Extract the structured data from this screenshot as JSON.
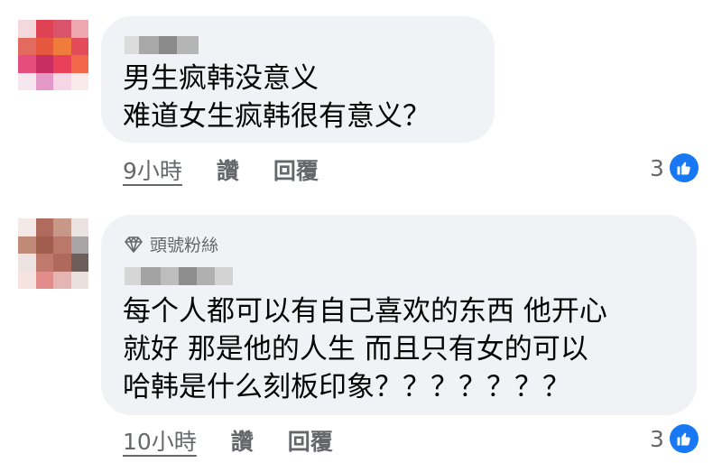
{
  "comments": [
    {
      "text_lines": [
        "男生疯韩没意义",
        "难道女生疯韩很有意义？"
      ],
      "time": "9小時",
      "like_label": "讚",
      "reply_label": "回覆",
      "reaction_count": "3",
      "reaction_icon": "like-icon"
    },
    {
      "badge": "頭號粉絲",
      "badge_icon": "diamond-icon",
      "text_lines": [
        "每个人都可以有自己喜欢的东西 他开心",
        "就好 那是他的人生 而且只有女的可以",
        "哈韩是什么刻板印象？？？？？？？"
      ],
      "time": "10小時",
      "like_label": "讚",
      "reply_label": "回覆",
      "reaction_count": "3",
      "reaction_icon": "like-icon"
    }
  ],
  "colors": {
    "bubble": "#f0f2f5",
    "meta_text": "#65676b",
    "like_blue": "#1877f2"
  }
}
